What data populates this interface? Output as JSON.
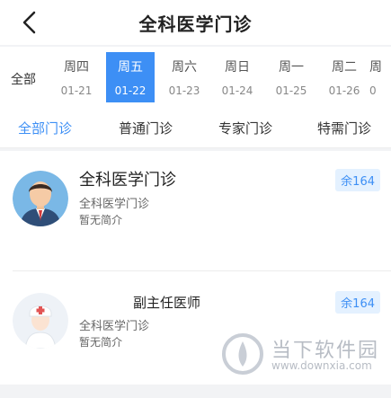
{
  "header": {
    "title": "全科医学门诊"
  },
  "dates": {
    "all_label": "全部",
    "days": [
      {
        "weekday": "周四",
        "date": "01-21"
      },
      {
        "weekday": "周五",
        "date": "01-22"
      },
      {
        "weekday": "周六",
        "date": "01-23"
      },
      {
        "weekday": "周日",
        "date": "01-24"
      },
      {
        "weekday": "周一",
        "date": "01-25"
      },
      {
        "weekday": "周二",
        "date": "01-26"
      },
      {
        "weekday": "周",
        "date": "0"
      }
    ],
    "selected_index": 1
  },
  "tabs": [
    {
      "label": "全部门诊"
    },
    {
      "label": "普通门诊"
    },
    {
      "label": "专家门诊"
    },
    {
      "label": "特需门诊"
    }
  ],
  "doctors": [
    {
      "name": "全科医学门诊",
      "dept": "全科医学门诊",
      "intro": "暂无简介",
      "remain": "余164"
    },
    {
      "name": "副主任医师",
      "dept": "全科医学门诊",
      "intro": "暂无简介",
      "remain": "余164"
    }
  ],
  "watermark": {
    "name": "当下软件园",
    "url": "www.downxia.com"
  },
  "colors": {
    "accent": "#3d8ff5",
    "badge_bg": "#e4f1ff"
  }
}
